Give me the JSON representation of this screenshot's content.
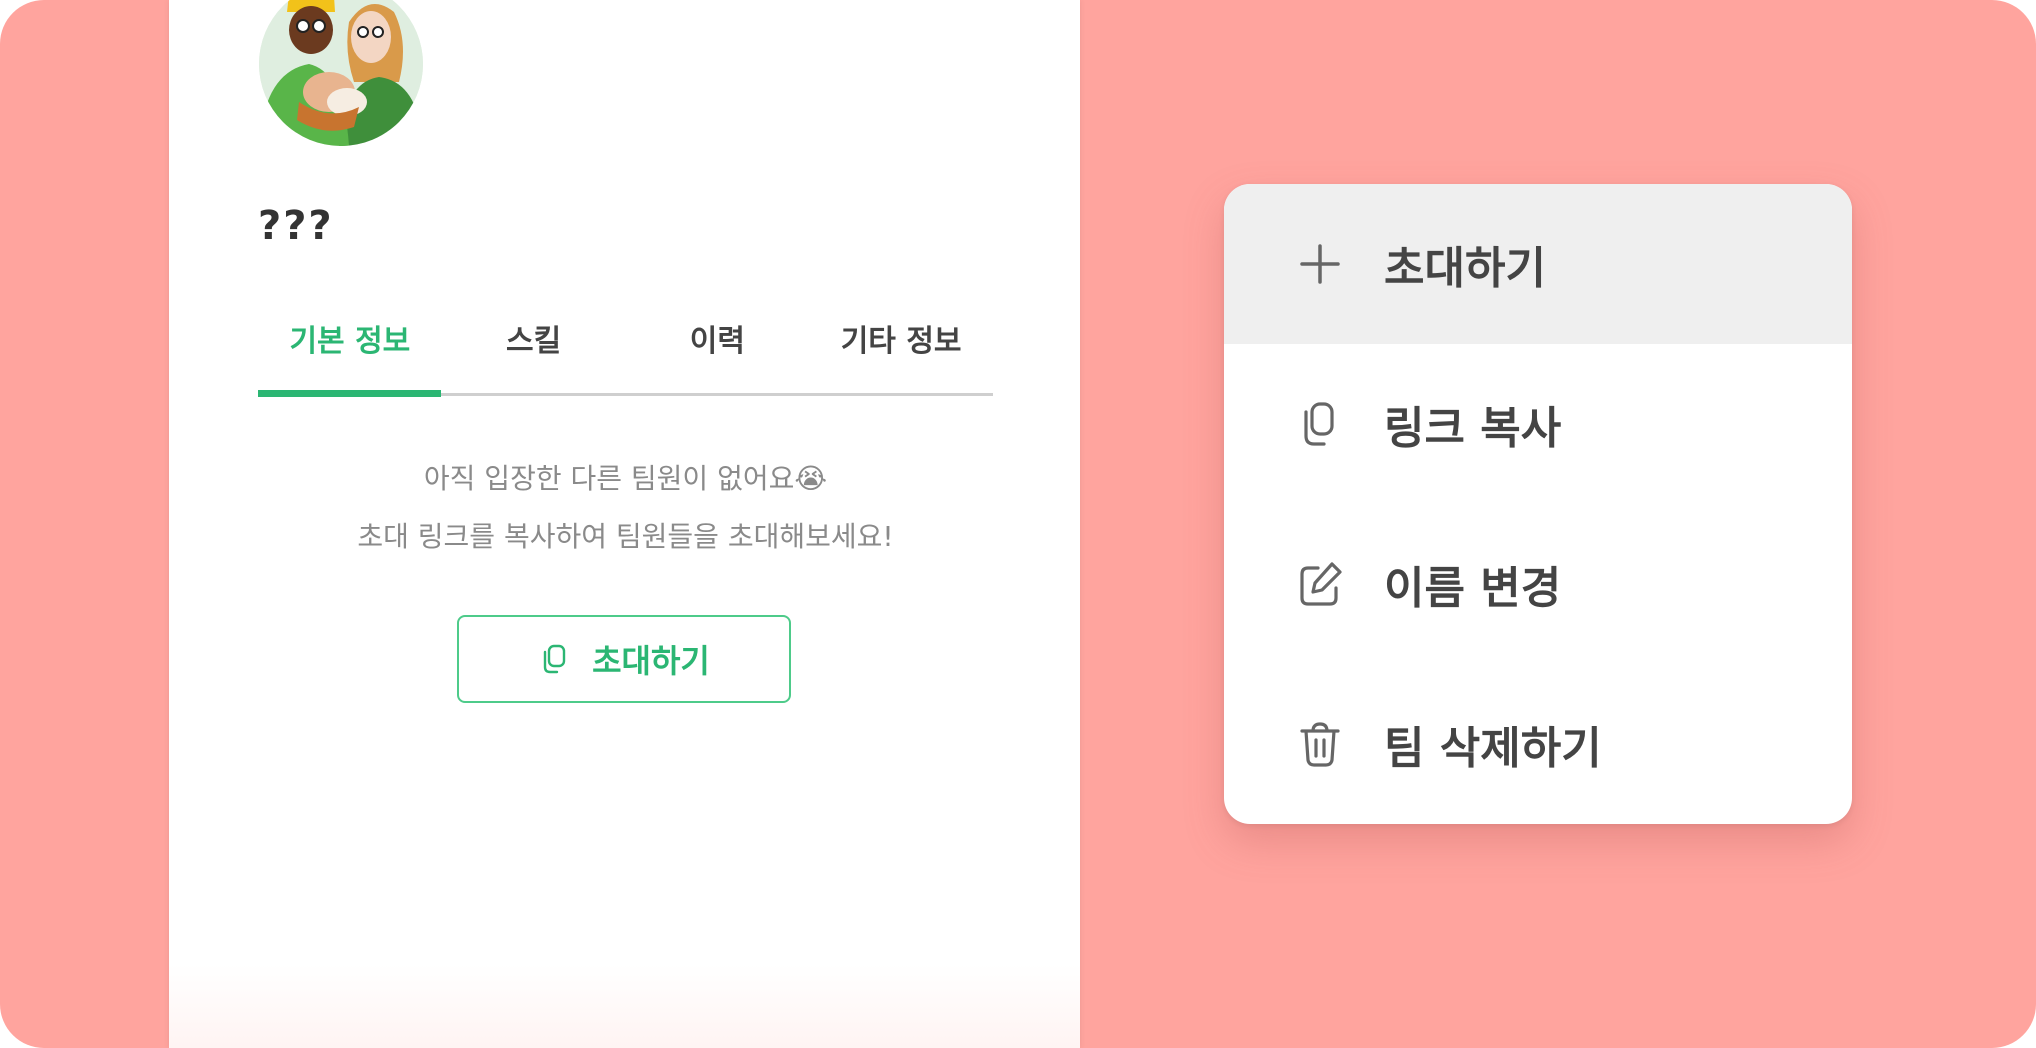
{
  "team": {
    "name": "???"
  },
  "tabs": [
    {
      "label": "기본 정보",
      "active": true
    },
    {
      "label": "스킬",
      "active": false
    },
    {
      "label": "이력",
      "active": false
    },
    {
      "label": "기타 정보",
      "active": false
    }
  ],
  "empty_state": {
    "line1": "아직 입장한 다른 팀원이 없어요😭",
    "line2": "초대 링크를 복사하여 팀원들을 초대해보세요!"
  },
  "invite_button": {
    "label": "초대하기",
    "icon": "copy-icon"
  },
  "menu": {
    "items": [
      {
        "label": "초대하기",
        "icon": "plus-icon"
      },
      {
        "label": "링크 복사",
        "icon": "copy-icon"
      },
      {
        "label": "이름 변경",
        "icon": "edit-icon"
      },
      {
        "label": "팀 삭제하기",
        "icon": "trash-icon"
      }
    ]
  },
  "colors": {
    "background": "#ffa49e",
    "accent": "#2bb673",
    "menu_highlight": "#efefef"
  }
}
